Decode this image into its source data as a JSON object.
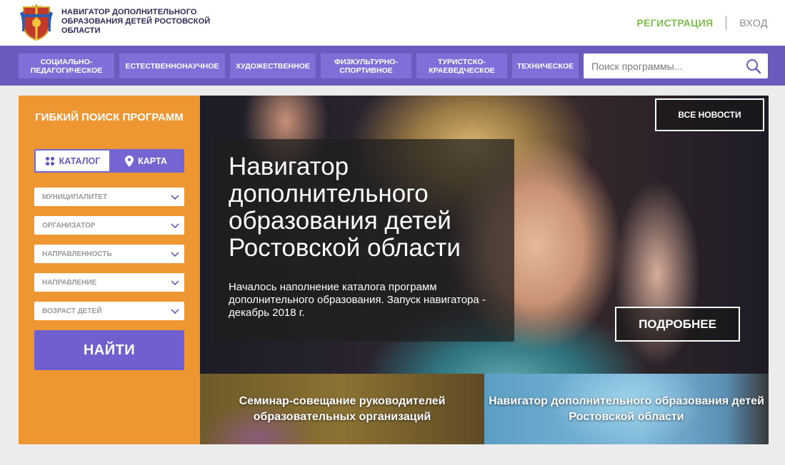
{
  "header": {
    "site_title": "НАВИГАТОР ДОПОЛНИТЕЛЬНОГО ОБРАЗОВАНИЯ ДЕТЕЙ РОСТОВСКОЙ ОБЛАСТИ",
    "register_label": "РЕГИСТРАЦИЯ",
    "login_label": "ВХОД"
  },
  "nav": {
    "items": [
      {
        "label": "СОЦИАЛЬНО-ПЕДАГОГИЧЕСКОЕ"
      },
      {
        "label": "ЕСТЕСТВЕННОНАУЧНОЕ"
      },
      {
        "label": "ХУДОЖЕСТВЕННОЕ"
      },
      {
        "label": "ФИЗКУЛЬТУРНО-СПОРТИВНОЕ"
      },
      {
        "label": "ТУРИСТСКО-КРАЕВЕДЧЕСКОЕ"
      },
      {
        "label": "ТЕХНИЧЕСКОЕ"
      }
    ],
    "search": {
      "placeholder": "Поиск программы...",
      "value": "",
      "icon": "search-icon"
    }
  },
  "sidebar": {
    "title": "ГИБКИЙ ПОИСК ПРОГРАММ",
    "toggle": {
      "catalog_label": "КАТАЛОГ",
      "map_label": "КАРТА",
      "active": "catalog"
    },
    "filters": [
      {
        "label": "МУНИЦИПАЛИТЕТ"
      },
      {
        "label": "ОРГАНИЗАТОР"
      },
      {
        "label": "НАПРАВЛЕННОСТЬ"
      },
      {
        "label": "НАПРАВЛЕНИЕ"
      },
      {
        "label": "ВОЗРАСТ ДЕТЕЙ"
      }
    ],
    "find_label": "НАЙТИ"
  },
  "hero": {
    "all_news_label": "ВСЕ НОВОСТИ",
    "title": "Навигатор дополнительного образования детей Ростовской области",
    "text": "Началось наполнение каталога программ дополнительного образования. Запуск навигатора - декабрь 2018 г.",
    "more_label": "ПОДРОБНЕЕ"
  },
  "news_cards": [
    {
      "title": "Семинар-совещание руководителей образовательных организаций"
    },
    {
      "title": "Навигатор дополнительного образования детей Ростовской области"
    }
  ],
  "colors": {
    "nav_bg": "#6a5bbf",
    "nav_button": "#7f6fd8",
    "sidebar_bg": "#ee9631",
    "accent_green": "#7bbf4c",
    "find_button": "#6f5fcf"
  }
}
